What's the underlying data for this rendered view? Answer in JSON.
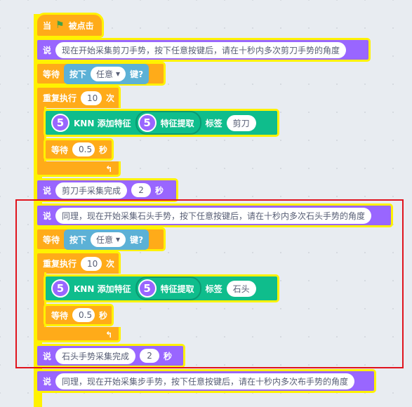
{
  "hat": {
    "label": "当",
    "flag_icon": "green-flag-icon",
    "suffix": "被点击"
  },
  "blocks": {
    "say1": {
      "label": "说",
      "text": "现在开始采集剪刀手势，按下任意按键后，请在十秒内多次剪刀手势的角度"
    },
    "wait1": {
      "label": "等待",
      "sense": "按下",
      "key": "任意",
      "tail": "键?"
    },
    "repeat1": {
      "label": "重复执行",
      "count": "10",
      "unit": "次"
    },
    "knn1": {
      "badge": "5",
      "label": "KNN 添加特征",
      "inner_badge": "5",
      "inner_label": "特征提取",
      "tag_label": "标签",
      "tag": "剪刀"
    },
    "waitsec1": {
      "label": "等待",
      "value": "0.5",
      "unit": "秒"
    },
    "say2": {
      "label": "说",
      "text": "剪刀手采集完成",
      "secs": "2",
      "unit": "秒"
    },
    "say3": {
      "label": "说",
      "text": "同理，现在开始采集石头手势，按下任意按键后，请在十秒内多次石头手势的角度"
    },
    "wait2": {
      "label": "等待",
      "sense": "按下",
      "key": "任意",
      "tail": "键?"
    },
    "repeat2": {
      "label": "重复执行",
      "count": "10",
      "unit": "次"
    },
    "knn2": {
      "badge": "5",
      "label": "KNN 添加特征",
      "inner_badge": "5",
      "inner_label": "特征提取",
      "tag_label": "标签",
      "tag": "石头"
    },
    "waitsec2": {
      "label": "等待",
      "value": "0.5",
      "unit": "秒"
    },
    "say4": {
      "label": "说",
      "text": "石头手势采集完成",
      "secs": "2",
      "unit": "秒"
    },
    "say5": {
      "label": "说",
      "text": "同理，现在开始采集步手势，按下任意按键后，请在十秒内多次布手势的角度"
    }
  },
  "colors": {
    "looks": "#9966ff",
    "control": "#ffab19",
    "extension": "#0fbd8c",
    "sensing": "#5cb1d6",
    "highlight": "#fff200",
    "annotation": "#e0141e"
  }
}
